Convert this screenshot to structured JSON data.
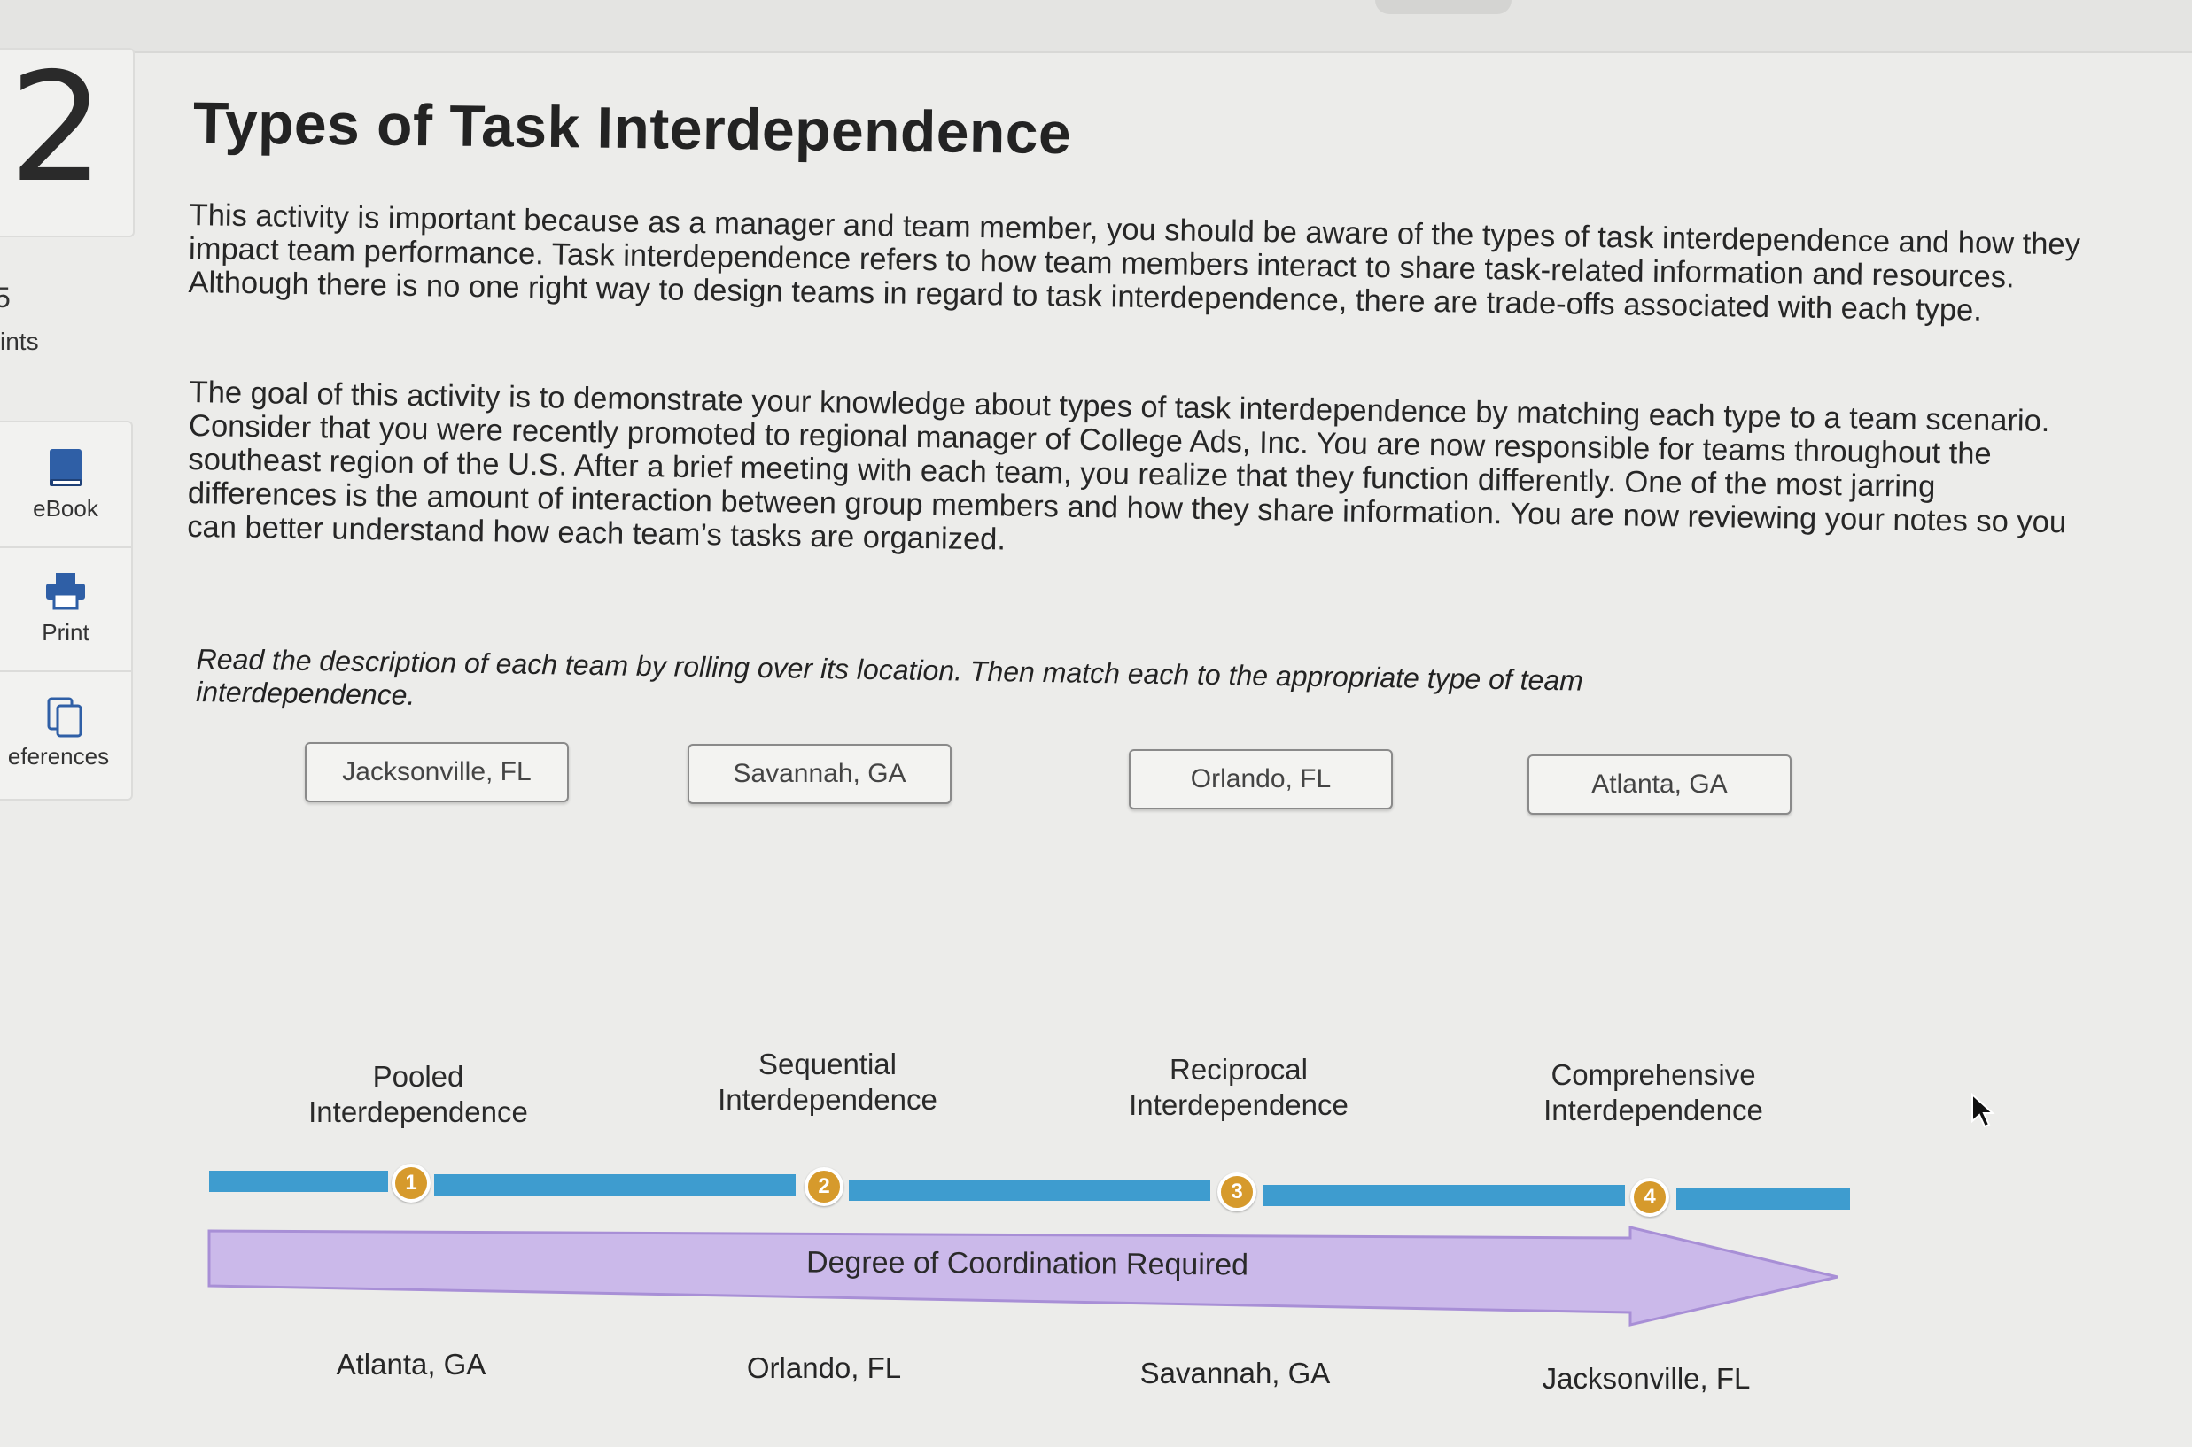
{
  "question": {
    "number": "2",
    "points_value": "5",
    "points_label": "ints"
  },
  "tools": [
    {
      "label": "eBook",
      "icon": "ebook-icon"
    },
    {
      "label": "Print",
      "icon": "print-icon"
    },
    {
      "label": "eferences",
      "icon": "references-icon"
    }
  ],
  "title": "Types of Task Interdependence",
  "paragraph1": "This activity is important because as a manager and team member, you should be aware of the types of task interdependence and how they impact team performance. Task interdependence refers to how team members interact to share task-related information and resources. Although there is no one right way to design teams in regard to task interdependence, there are trade-offs associated with each type.",
  "paragraph2": "The goal of this activity is to demonstrate your knowledge about types of task interdependence by matching each type to a team scenario. Consider that you were recently promoted to regional manager of College Ads, Inc. You are now responsible for teams throughout the southeast region of the U.S. After a brief meeting with each team, you realize that they function differently. One of the most jarring differences is the amount of interaction between group members and how they share information. You are now reviewing your notes so you can better understand how each team’s tasks are organized.",
  "instructions": "Read the description of each team by rolling over its location. Then match each to the appropriate type of team interdependence.",
  "locations": [
    "Jacksonville, FL",
    "Savannah, GA",
    "Orlando, FL",
    "Atlanta, GA"
  ],
  "types": [
    {
      "line1": "Pooled",
      "line2": "Interdependence",
      "marker": "1",
      "answer": "Atlanta, GA"
    },
    {
      "line1": "Sequential",
      "line2": "Interdependence",
      "marker": "2",
      "answer": "Orlando, FL"
    },
    {
      "line1": "Reciprocal",
      "line2": "Interdependence",
      "marker": "3",
      "answer": "Savannah, GA"
    },
    {
      "line1": "Comprehensive",
      "line2": "Interdependence",
      "marker": "4",
      "answer": "Jacksonville, FL"
    }
  ],
  "arrow_label": "Degree of Coordination Required",
  "colors": {
    "bar": "#3e9ccf",
    "marker": "#d69a2c",
    "arrow_fill": "#cbb9ea",
    "arrow_stroke": "#a88fd6"
  }
}
